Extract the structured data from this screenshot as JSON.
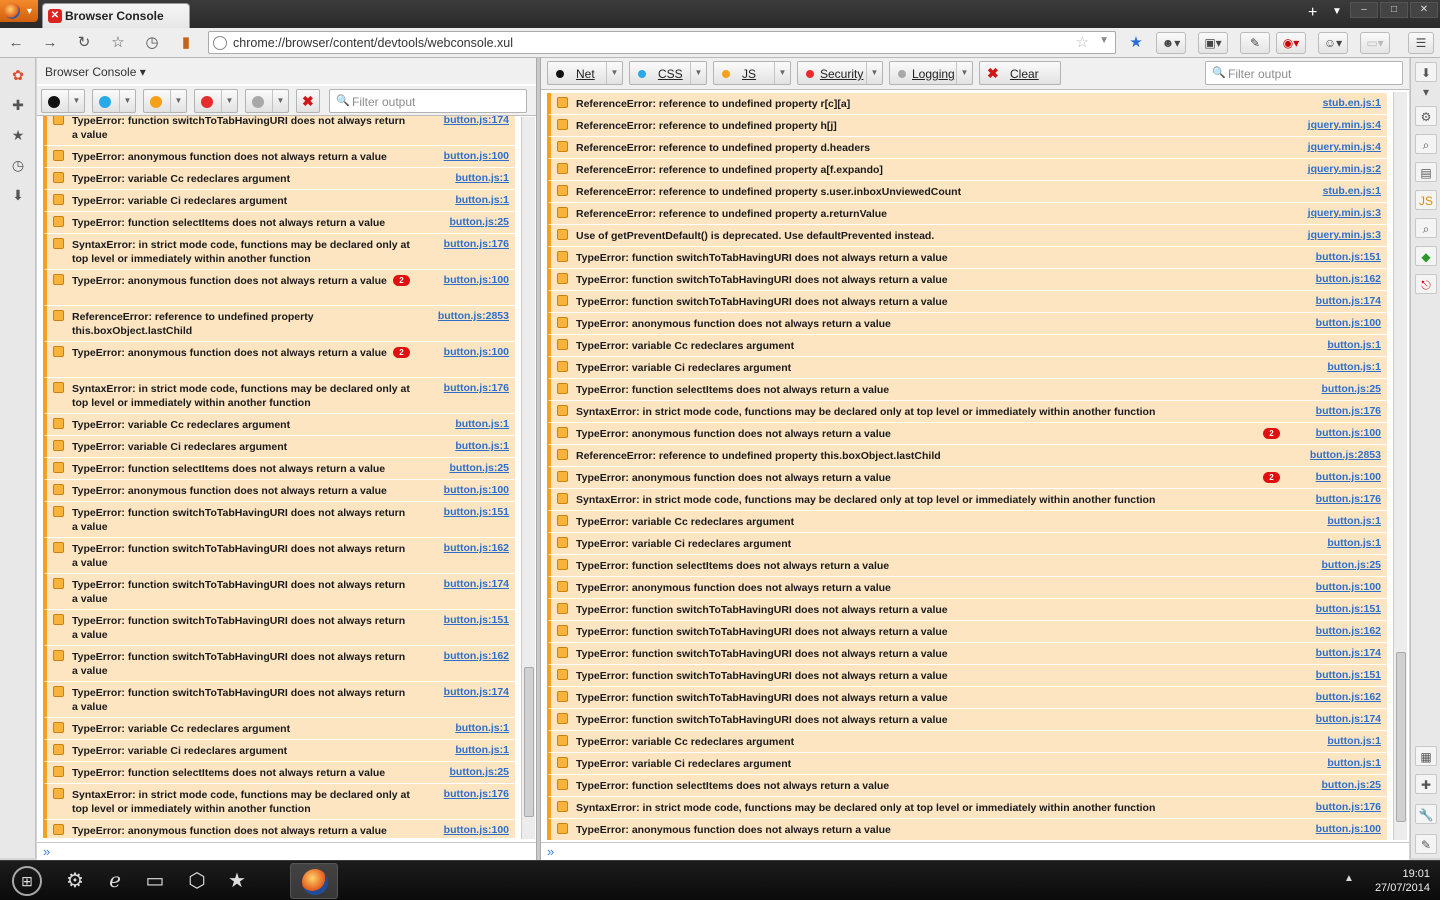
{
  "window": {
    "tab_title": "Browser Console",
    "controls": [
      "–",
      "□",
      "✕"
    ]
  },
  "navbar": {
    "url": "chrome://browser/content/devtools/webconsole.xul"
  },
  "left_pane": {
    "title": "Browser Console",
    "filter_placeholder": "Filter output",
    "messages": [
      {
        "text": "TypeError: function switchToTabHavingURI does not always return a value",
        "src": "button.js:174",
        "tall": true,
        "badge": ""
      },
      {
        "text": "TypeError: anonymous function does not always return a value",
        "src": "button.js:100",
        "tall": false,
        "badge": ""
      },
      {
        "text": "TypeError: variable Cc redeclares argument",
        "src": "button.js:1",
        "tall": false,
        "badge": ""
      },
      {
        "text": "TypeError: variable Ci redeclares argument",
        "src": "button.js:1",
        "tall": false,
        "badge": ""
      },
      {
        "text": "TypeError: function selectItems does not always return a value",
        "src": "button.js:25",
        "tall": false,
        "badge": ""
      },
      {
        "text": "SyntaxError: in strict mode code, functions may be declared only at top level or immediately within another function",
        "src": "button.js:176",
        "tall": true,
        "badge": ""
      },
      {
        "text": "TypeError: anonymous function does not always return a value",
        "src": "button.js:100",
        "tall": true,
        "badge": "2"
      },
      {
        "text": "ReferenceError: reference to undefined property this.boxObject.lastChild",
        "src": "button.js:2853",
        "tall": true,
        "badge": ""
      },
      {
        "text": "TypeError: anonymous function does not always return a value",
        "src": "button.js:100",
        "tall": true,
        "badge": "2"
      },
      {
        "text": "SyntaxError: in strict mode code, functions may be declared only at top level or immediately within another function",
        "src": "button.js:176",
        "tall": true,
        "badge": ""
      },
      {
        "text": "TypeError: variable Cc redeclares argument",
        "src": "button.js:1",
        "tall": false,
        "badge": ""
      },
      {
        "text": "TypeError: variable Ci redeclares argument",
        "src": "button.js:1",
        "tall": false,
        "badge": ""
      },
      {
        "text": "TypeError: function selectItems does not always return a value",
        "src": "button.js:25",
        "tall": false,
        "badge": ""
      },
      {
        "text": "TypeError: anonymous function does not always return a value",
        "src": "button.js:100",
        "tall": false,
        "badge": ""
      },
      {
        "text": "TypeError: function switchToTabHavingURI does not always return a value",
        "src": "button.js:151",
        "tall": true,
        "badge": ""
      },
      {
        "text": "TypeError: function switchToTabHavingURI does not always return a value",
        "src": "button.js:162",
        "tall": true,
        "badge": ""
      },
      {
        "text": "TypeError: function switchToTabHavingURI does not always return a value",
        "src": "button.js:174",
        "tall": true,
        "badge": ""
      },
      {
        "text": "TypeError: function switchToTabHavingURI does not always return a value",
        "src": "button.js:151",
        "tall": true,
        "badge": ""
      },
      {
        "text": "TypeError: function switchToTabHavingURI does not always return a value",
        "src": "button.js:162",
        "tall": true,
        "badge": ""
      },
      {
        "text": "TypeError: function switchToTabHavingURI does not always return a value",
        "src": "button.js:174",
        "tall": true,
        "badge": ""
      },
      {
        "text": "TypeError: variable Cc redeclares argument",
        "src": "button.js:1",
        "tall": false,
        "badge": ""
      },
      {
        "text": "TypeError: variable Ci redeclares argument",
        "src": "button.js:1",
        "tall": false,
        "badge": ""
      },
      {
        "text": "TypeError: function selectItems does not always return a value",
        "src": "button.js:25",
        "tall": false,
        "badge": ""
      },
      {
        "text": "SyntaxError: in strict mode code, functions may be declared only at top level or immediately within another function",
        "src": "button.js:176",
        "tall": true,
        "badge": ""
      },
      {
        "text": "TypeError: anonymous function does not always return a value",
        "src": "button.js:100",
        "tall": false,
        "badge": ""
      }
    ]
  },
  "right_pane": {
    "filters": {
      "net": "Net",
      "css": "CSS",
      "js": "JS",
      "security": "Security",
      "logging": "Logging",
      "clear": "Clear"
    },
    "filter_placeholder": "Filter output",
    "messages": [
      {
        "text": "ReferenceError: reference to undefined property r[c][a]",
        "src": "stub.en.js:1",
        "badge": ""
      },
      {
        "text": "ReferenceError: reference to undefined property h[j]",
        "src": "jquery.min.js:4",
        "badge": ""
      },
      {
        "text": "ReferenceError: reference to undefined property d.headers",
        "src": "jquery.min.js:4",
        "badge": ""
      },
      {
        "text": "ReferenceError: reference to undefined property a[f.expando]",
        "src": "jquery.min.js:2",
        "badge": ""
      },
      {
        "text": "ReferenceError: reference to undefined property s.user.inboxUnviewedCount",
        "src": "stub.en.js:1",
        "badge": ""
      },
      {
        "text": "ReferenceError: reference to undefined property a.returnValue",
        "src": "jquery.min.js:3",
        "badge": ""
      },
      {
        "text": "Use of getPreventDefault() is deprecated.  Use defaultPrevented instead.",
        "src": "jquery.min.js:3",
        "badge": ""
      },
      {
        "text": "TypeError: function switchToTabHavingURI does not always return a value",
        "src": "button.js:151",
        "badge": ""
      },
      {
        "text": "TypeError: function switchToTabHavingURI does not always return a value",
        "src": "button.js:162",
        "badge": ""
      },
      {
        "text": "TypeError: function switchToTabHavingURI does not always return a value",
        "src": "button.js:174",
        "badge": ""
      },
      {
        "text": "TypeError: anonymous function does not always return a value",
        "src": "button.js:100",
        "badge": ""
      },
      {
        "text": "TypeError: variable Cc redeclares argument",
        "src": "button.js:1",
        "badge": ""
      },
      {
        "text": "TypeError: variable Ci redeclares argument",
        "src": "button.js:1",
        "badge": ""
      },
      {
        "text": "TypeError: function selectItems does not always return a value",
        "src": "button.js:25",
        "badge": ""
      },
      {
        "text": "SyntaxError: in strict mode code, functions may be declared only at top level or immediately within another function",
        "src": "button.js:176",
        "badge": ""
      },
      {
        "text": "TypeError: anonymous function does not always return a value",
        "src": "button.js:100",
        "badge": "2"
      },
      {
        "text": "ReferenceError: reference to undefined property this.boxObject.lastChild",
        "src": "button.js:2853",
        "badge": ""
      },
      {
        "text": "TypeError: anonymous function does not always return a value",
        "src": "button.js:100",
        "badge": "2"
      },
      {
        "text": "SyntaxError: in strict mode code, functions may be declared only at top level or immediately within another function",
        "src": "button.js:176",
        "badge": ""
      },
      {
        "text": "TypeError: variable Cc redeclares argument",
        "src": "button.js:1",
        "badge": ""
      },
      {
        "text": "TypeError: variable Ci redeclares argument",
        "src": "button.js:1",
        "badge": ""
      },
      {
        "text": "TypeError: function selectItems does not always return a value",
        "src": "button.js:25",
        "badge": ""
      },
      {
        "text": "TypeError: anonymous function does not always return a value",
        "src": "button.js:100",
        "badge": ""
      },
      {
        "text": "TypeError: function switchToTabHavingURI does not always return a value",
        "src": "button.js:151",
        "badge": ""
      },
      {
        "text": "TypeError: function switchToTabHavingURI does not always return a value",
        "src": "button.js:162",
        "badge": ""
      },
      {
        "text": "TypeError: function switchToTabHavingURI does not always return a value",
        "src": "button.js:174",
        "badge": ""
      },
      {
        "text": "TypeError: function switchToTabHavingURI does not always return a value",
        "src": "button.js:151",
        "badge": ""
      },
      {
        "text": "TypeError: function switchToTabHavingURI does not always return a value",
        "src": "button.js:162",
        "badge": ""
      },
      {
        "text": "TypeError: function switchToTabHavingURI does not always return a value",
        "src": "button.js:174",
        "badge": ""
      },
      {
        "text": "TypeError: variable Cc redeclares argument",
        "src": "button.js:1",
        "badge": ""
      },
      {
        "text": "TypeError: variable Ci redeclares argument",
        "src": "button.js:1",
        "badge": ""
      },
      {
        "text": "TypeError: function selectItems does not always return a value",
        "src": "button.js:25",
        "badge": ""
      },
      {
        "text": "SyntaxError: in strict mode code, functions may be declared only at top level or immediately within another function",
        "src": "button.js:176",
        "badge": ""
      },
      {
        "text": "TypeError: anonymous function does not always return a value",
        "src": "button.js:100",
        "badge": ""
      }
    ]
  },
  "command_prompt": "»",
  "taskbar": {
    "time": "19:01",
    "date": "27/07/2014"
  },
  "colors": {
    "message_bg": "#fde5c2",
    "message_border": "#f4a020",
    "link": "#2f6fc9",
    "badge": "#e01010"
  }
}
